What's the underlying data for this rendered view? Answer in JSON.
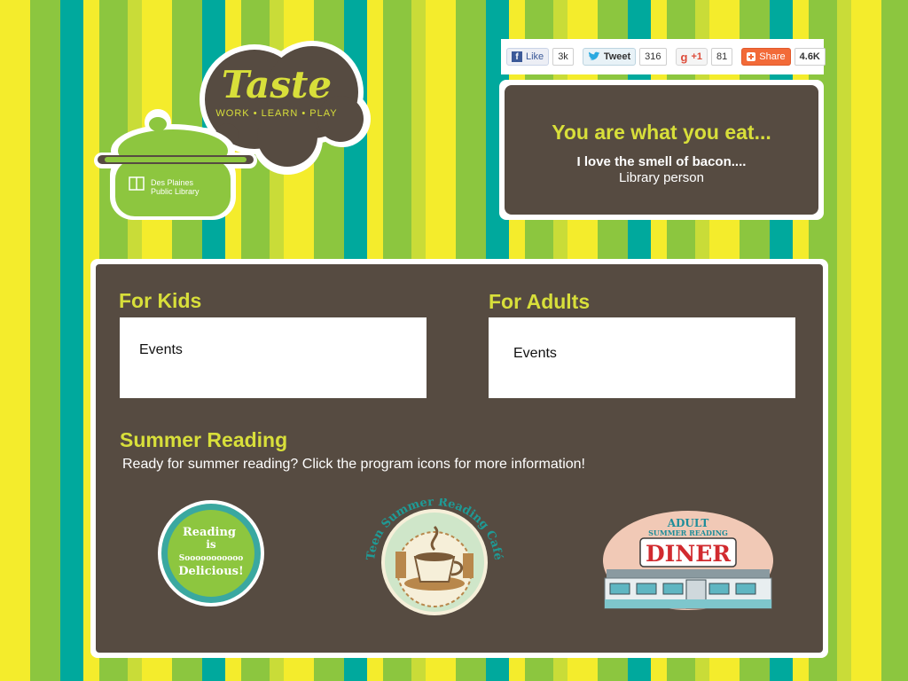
{
  "logo": {
    "title": "Taste",
    "tagline": "WORK • LEARN • PLAY",
    "library_line1": "Des Plaines",
    "library_line2": "Public Library"
  },
  "social": {
    "like_label": "Like",
    "like_count": "3k",
    "tweet_label": "Tweet",
    "tweet_count": "316",
    "plusone_label": "+1",
    "plusone_count": "81",
    "share_label": "Share",
    "share_count": "4.6K"
  },
  "quote": {
    "title": "You are what you eat...",
    "line1": "I love the smell of bacon....",
    "line2": "Library person"
  },
  "kids": {
    "title": "For Kids",
    "link": "Events"
  },
  "adults": {
    "title": "For Adults",
    "link": "Events"
  },
  "summer": {
    "title": "Summer Reading",
    "intro": "Ready for summer reading? Click the program icons for more information!",
    "kids_badge": {
      "line1": "Reading",
      "line2": "is",
      "line3": "Sooooooooooo",
      "line4": "Delicious!"
    },
    "teen_badge": {
      "arc_text": "Teen Summer Reading Café"
    },
    "adult_badge": {
      "line1": "ADULT",
      "line2": "SUMMER READING",
      "line3": "DINER"
    }
  },
  "colors": {
    "panel_brown": "#564b41",
    "accent_yellow": "#d8df3a",
    "logo_green": "#8dc63f",
    "stripe_teal": "#00a99d",
    "stripe_yellow": "#f4ec2c"
  }
}
